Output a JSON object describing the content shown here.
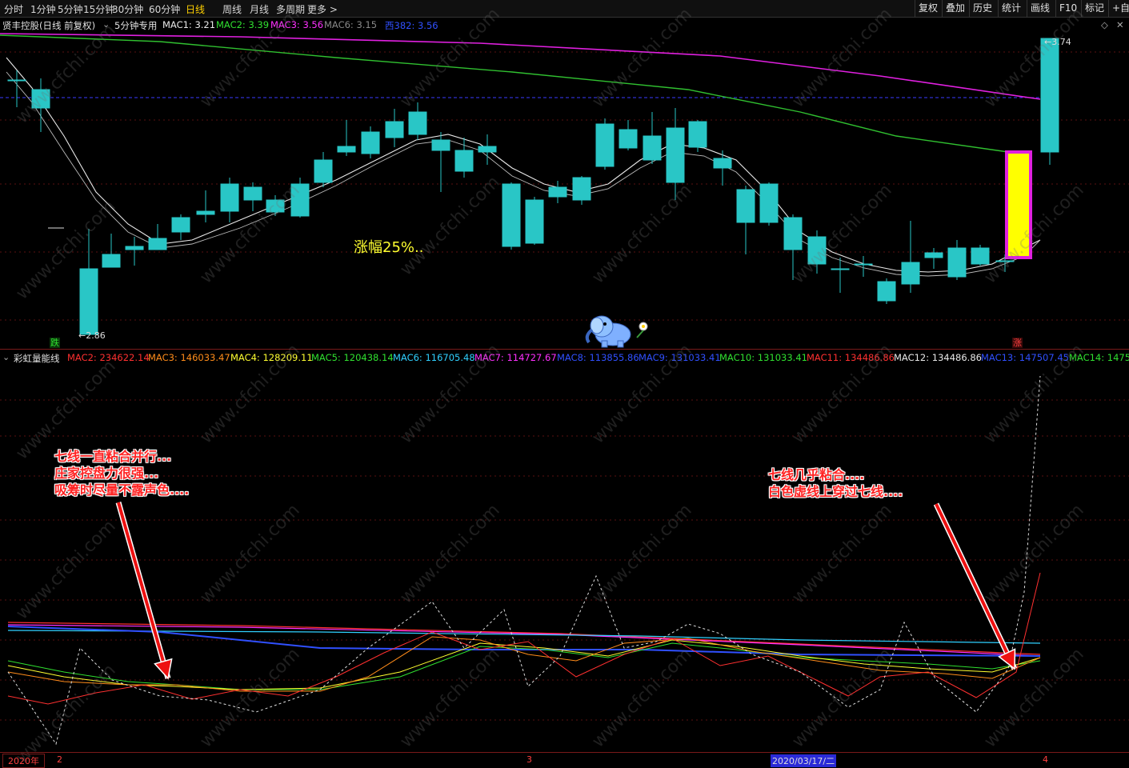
{
  "toolbar": {
    "periods": [
      {
        "label": "分时",
        "active": false
      },
      {
        "label": "1分钟",
        "active": false
      },
      {
        "label": "5分钟",
        "active": false
      },
      {
        "label": "15分钟",
        "active": false
      },
      {
        "label": "30分钟",
        "active": false
      },
      {
        "label": "60分钟",
        "active": false
      },
      {
        "label": "日线",
        "active": true
      },
      {
        "label": "周线",
        "active": false
      },
      {
        "label": "月线",
        "active": false
      },
      {
        "label": "多周期",
        "active": false
      },
      {
        "label": "更多 >",
        "active": false
      }
    ],
    "right_buttons": [
      "复权",
      "叠加",
      "历史",
      "统计",
      "画线",
      "F10",
      "标记",
      "+自选"
    ]
  },
  "main_header": {
    "stock": "贤丰控股(日线 前复权)",
    "preset": "5分钟专用",
    "mac1": "MAC1: 3.21",
    "mac2": "MAC2: 3.39",
    "mac3": "MAC3: 3.56",
    "mac6": "MAC6: 3.15",
    "xi382": "西382: 3.56"
  },
  "main_chart": {
    "high_label": "3.74",
    "low_label": "2.86",
    "gain_text": "涨幅25%..",
    "down_mark": "跌",
    "up_mark": "涨",
    "colors": {
      "bull": "#ff3030",
      "bear": "#29c6c6",
      "magenta": "#e020e0",
      "green": "#30c030",
      "white": "#e8e8e8",
      "highlight": "#ffff00"
    }
  },
  "indicator_header": {
    "name": "彩虹量能线",
    "items": [
      {
        "text": "MAC2: 234622.14",
        "color": "#ff3030"
      },
      {
        "text": "MAC3: 146033.47",
        "color": "#ff8c1a"
      },
      {
        "text": "MAC4: 128209.11",
        "color": "#ffff30"
      },
      {
        "text": "MAC5: 120438.14",
        "color": "#30e030"
      },
      {
        "text": "MAC6: 116705.48",
        "color": "#30d0ff"
      },
      {
        "text": "MAC7: 114727.67",
        "color": "#ff30ff"
      },
      {
        "text": "MAC8: 113855.86",
        "color": "#3050ff"
      },
      {
        "text": "MAC9: 131033.41",
        "color": "#3050ff"
      },
      {
        "text": "MAC10: 131033.41",
        "color": "#30e030"
      },
      {
        "text": "MAC11: 134486.86",
        "color": "#ff3030"
      },
      {
        "text": "MAC12: 134486.86",
        "color": "#e8e8e8"
      },
      {
        "text": "MAC13: 147507.45",
        "color": "#3050ff"
      },
      {
        "text": "MAC14: 1475",
        "color": "#30e030"
      }
    ]
  },
  "annotations": {
    "left": [
      "七线一直粘合并行...",
      "庄家控盘力很强...",
      "吸筹时尽量不露声色...."
    ],
    "right": [
      "七线几乎粘合....",
      "白色虚线上穿过七线...."
    ]
  },
  "footer": {
    "year": "2020年",
    "m2": "2",
    "m3": "3",
    "date": "2020/03/17/二",
    "m4": "4"
  },
  "watermark": "www.cfchi.com"
}
